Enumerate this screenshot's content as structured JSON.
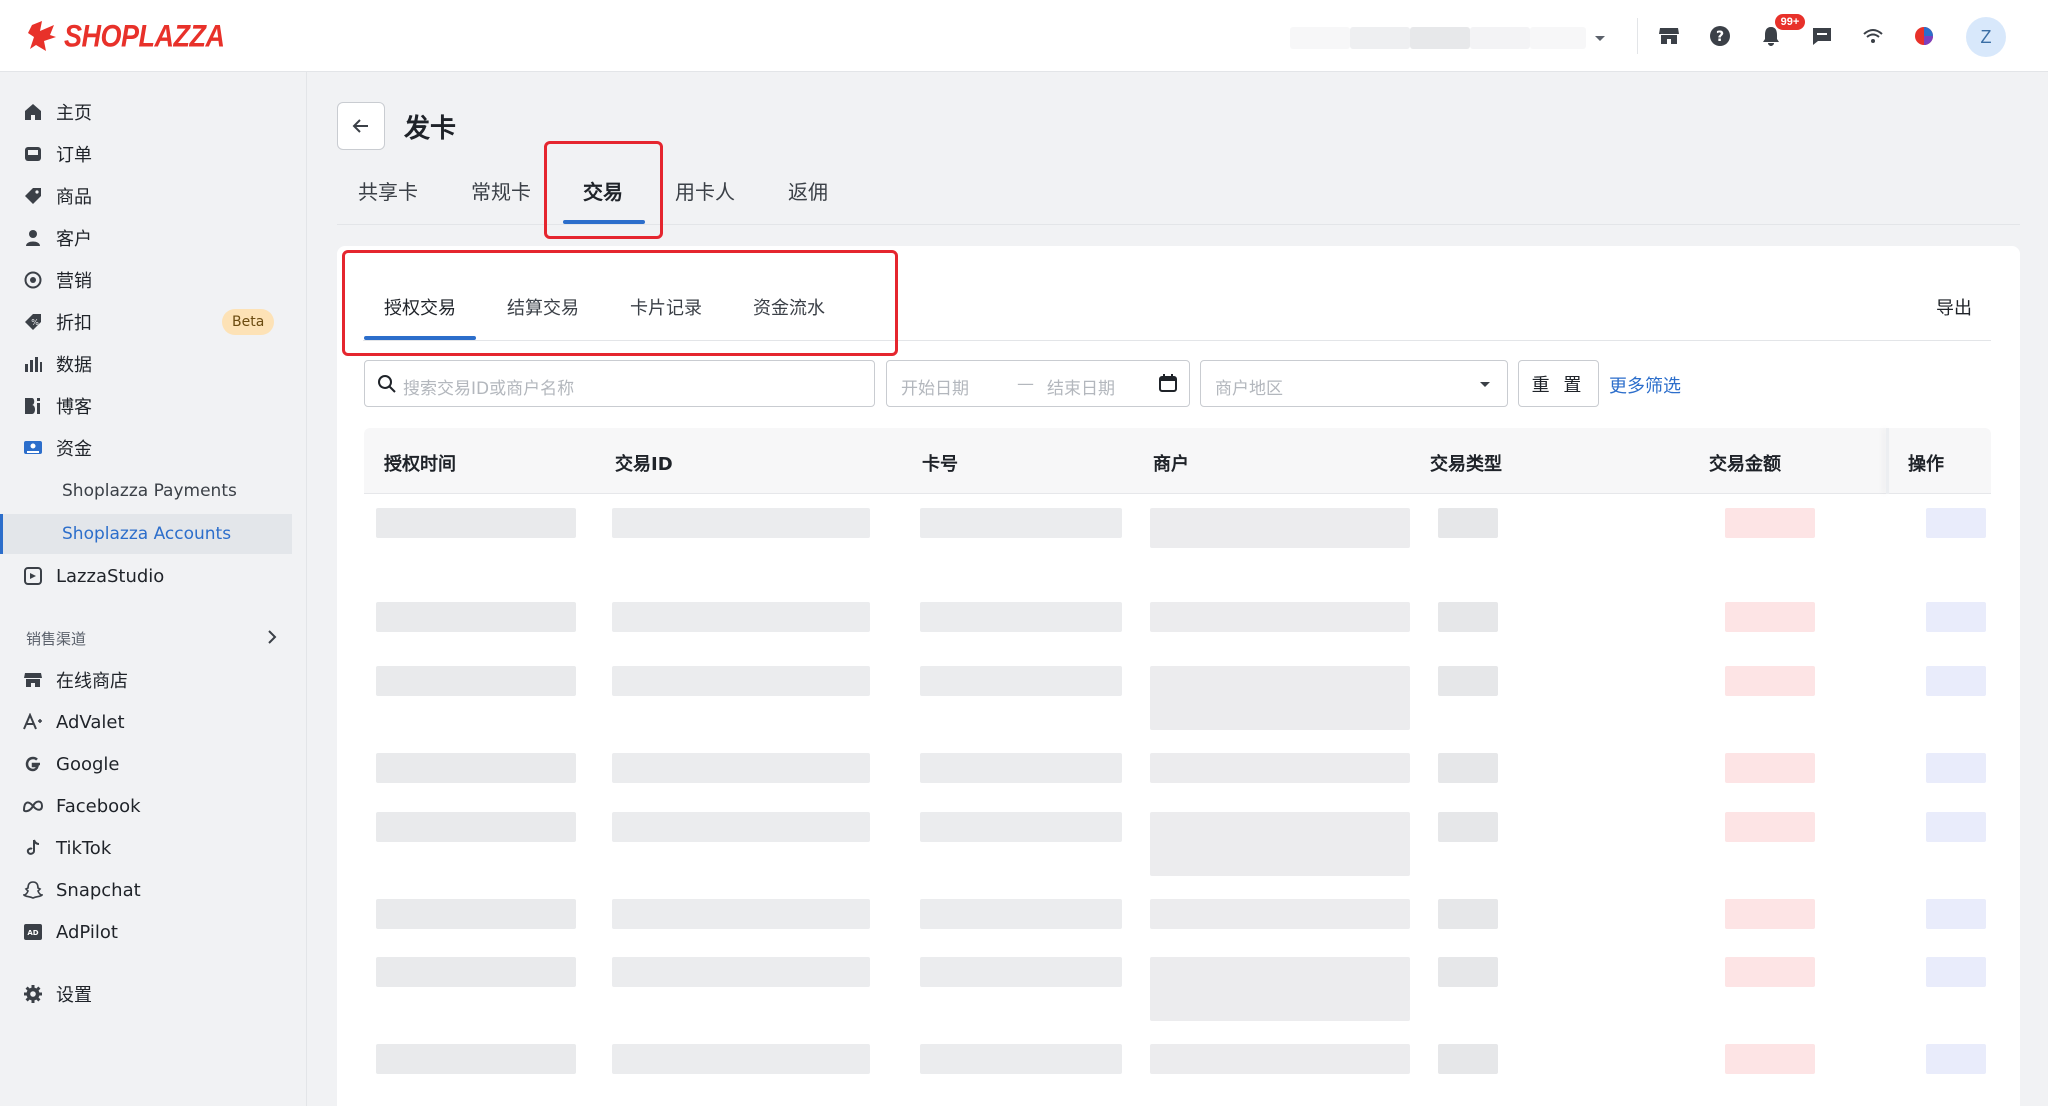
{
  "brand": {
    "name": "SHOPLAZZA",
    "color": "#e8312a"
  },
  "topbar": {
    "notifications_badge": "99+",
    "avatar_initial": "Z",
    "icons": [
      "store-icon",
      "help-icon",
      "bell-icon",
      "chat-icon",
      "wifi-icon",
      "color-ball-icon"
    ]
  },
  "sidebar": {
    "items": [
      {
        "label": "主页",
        "icon": "home-icon"
      },
      {
        "label": "订单",
        "icon": "inbox-icon"
      },
      {
        "label": "商品",
        "icon": "tag-icon"
      },
      {
        "label": "客户",
        "icon": "person-icon"
      },
      {
        "label": "营销",
        "icon": "target-icon"
      },
      {
        "label": "折扣",
        "icon": "discount-icon",
        "badge": "Beta"
      },
      {
        "label": "数据",
        "icon": "bar-chart-icon"
      },
      {
        "label": "博客",
        "icon": "blog-icon"
      },
      {
        "label": "资金",
        "icon": "money-icon"
      }
    ],
    "sub_items": [
      {
        "label": "Shoplazza Payments"
      },
      {
        "label": "Shoplazza Accounts",
        "active": true
      }
    ],
    "lazza": {
      "label": "LazzaStudio",
      "icon": "studio-icon"
    },
    "channels_label": "销售渠道",
    "channels": [
      {
        "label": "在线商店",
        "icon": "store-icon"
      },
      {
        "label": "AdValet",
        "icon": "advalet-icon"
      },
      {
        "label": "Google",
        "icon": "google-icon"
      },
      {
        "label": "Facebook",
        "icon": "meta-icon"
      },
      {
        "label": "TikTok",
        "icon": "tiktok-icon"
      },
      {
        "label": "Snapchat",
        "icon": "snapchat-icon"
      },
      {
        "label": "AdPilot",
        "icon": "adpilot-icon"
      }
    ],
    "settings": {
      "label": "设置",
      "icon": "gear-icon"
    }
  },
  "page": {
    "title": "发卡",
    "tabs": [
      "共享卡",
      "常规卡",
      "交易",
      "用卡人",
      "返佣"
    ],
    "active_tab": "交易",
    "subtabs": [
      "授权交易",
      "结算交易",
      "卡片记录",
      "资金流水"
    ],
    "active_subtab": "授权交易",
    "export_label": "导出"
  },
  "filters": {
    "search_placeholder": "搜索交易ID或商户名称",
    "start_date_placeholder": "开始日期",
    "date_separator": "—",
    "end_date_placeholder": "结束日期",
    "region_placeholder": "商户地区",
    "reset_label": "重 置",
    "more_filters_label": "更多筛选"
  },
  "table": {
    "columns": [
      "授权时间",
      "交易ID",
      "卡号",
      "商户",
      "交易类型",
      "交易金额",
      "操作"
    ]
  },
  "colors": {
    "accent": "#2c6ecb",
    "highlight": "#e5262f"
  }
}
